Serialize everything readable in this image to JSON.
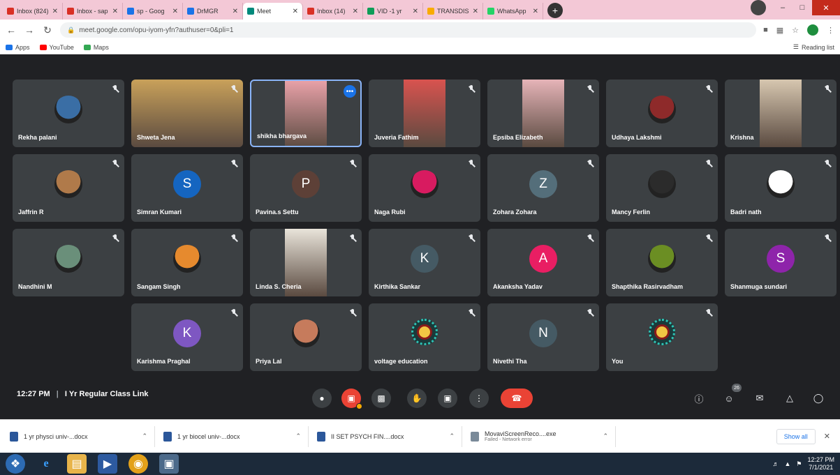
{
  "browser": {
    "tabs": [
      {
        "label": "Inbox (824)",
        "color": "#d93025",
        "active": false
      },
      {
        "label": "Inbox - sap",
        "color": "#d93025",
        "active": false
      },
      {
        "label": "sp - Goog",
        "color": "#1a73e8",
        "active": false
      },
      {
        "label": "DrMGR",
        "color": "#1a73e8",
        "active": false
      },
      {
        "label": "Meet",
        "color": "#00897b",
        "active": true
      },
      {
        "label": "Inbox (14)",
        "color": "#d93025",
        "active": false
      },
      {
        "label": "VID -1 yr",
        "color": "#0f9d58",
        "active": false
      },
      {
        "label": "TRANSDIS",
        "color": "#f9ab00",
        "active": false
      },
      {
        "label": "WhatsApp",
        "color": "#25d366",
        "active": false
      }
    ],
    "new_tab_label": "+",
    "url": "meet.google.com/opu-iyom-yfn?authuser=0&pli=1",
    "bookmarks": [
      {
        "label": "Apps",
        "color": "#1a73e8"
      },
      {
        "label": "YouTube",
        "color": "#ff0000"
      },
      {
        "label": "Maps",
        "color": "#34a853"
      }
    ],
    "reading_list": "Reading list"
  },
  "participants": [
    {
      "name": "Rekha palani",
      "kind": "photo",
      "color": "#3a6ea5"
    },
    {
      "name": "Shweta Jena",
      "kind": "video",
      "color": "#c9a15a"
    },
    {
      "name": "shikha bhargava",
      "kind": "video",
      "color": "#e8a1a8",
      "selected": true
    },
    {
      "name": "Juveria Fathim",
      "kind": "video",
      "color": "#d9534f"
    },
    {
      "name": "Epsiba Elizabeth",
      "kind": "video",
      "color": "#e6b4b8"
    },
    {
      "name": "Udhaya Lakshmi",
      "kind": "photo",
      "color": "#8e2a2a"
    },
    {
      "name": "Krishna",
      "kind": "video",
      "color": "#d7c7b0"
    },
    {
      "name": "Jaffrin R",
      "kind": "photo",
      "color": "#b07a4a"
    },
    {
      "name": "Simran Kumari",
      "kind": "letter",
      "letter": "S",
      "color": "#1565c0"
    },
    {
      "name": "Pavina.s Settu",
      "kind": "letter",
      "letter": "P",
      "color": "#5d4037"
    },
    {
      "name": "Naga Rubi",
      "kind": "photo",
      "color": "#d81b60"
    },
    {
      "name": "Zohara Zohara",
      "kind": "letter",
      "letter": "Z",
      "color": "#546e7a"
    },
    {
      "name": "Mancy Ferlin",
      "kind": "photo",
      "color": "#2b2b2b"
    },
    {
      "name": "Badri nath",
      "kind": "photo",
      "color": "#ffffff"
    },
    {
      "name": "Nandhini M",
      "kind": "photo",
      "color": "#6a8f7a"
    },
    {
      "name": "Sangam Singh",
      "kind": "photo",
      "color": "#e68a2e"
    },
    {
      "name": "Linda S. Cheria",
      "kind": "video",
      "color": "#e9e4da"
    },
    {
      "name": "Kirthika Sankar",
      "kind": "letter",
      "letter": "K",
      "color": "#455a64"
    },
    {
      "name": "Akanksha Yadav",
      "kind": "letter",
      "letter": "A",
      "color": "#e91e63"
    },
    {
      "name": "Shapthika Rasirvadham",
      "kind": "photo",
      "color": "#6b8e23"
    },
    {
      "name": "Shanmuga sundari",
      "kind": "letter",
      "letter": "S",
      "color": "#8e24aa"
    },
    {
      "name": "Karishma Praghal",
      "kind": "letter",
      "letter": "K",
      "color": "#7e57c2"
    },
    {
      "name": "Priya Lal",
      "kind": "photo",
      "color": "#c67b5c"
    },
    {
      "name": "voltage education",
      "kind": "logo",
      "color": "#2ec4b6"
    },
    {
      "name": "Nivethi Tha",
      "kind": "letter",
      "letter": "N",
      "color": "#455a64"
    },
    {
      "name": "You",
      "kind": "logo",
      "color": "#2ec4b6"
    }
  ],
  "meeting": {
    "time": "12:27 PM",
    "separator": "|",
    "title": "I Yr Regular Class Link",
    "participant_count": "26"
  },
  "downloads": [
    {
      "name": "1 yr physci univ-...docx",
      "sub": ""
    },
    {
      "name": "1 yr biocel univ-...docx",
      "sub": ""
    },
    {
      "name": "II SET PSYCH FIN....docx",
      "sub": ""
    },
    {
      "name": "MovaviScreenReco....exe",
      "sub": "Failed - Network error"
    }
  ],
  "show_all": "Show all",
  "taskbar": {
    "time": "12:27 PM",
    "date": "7/1/2021"
  }
}
